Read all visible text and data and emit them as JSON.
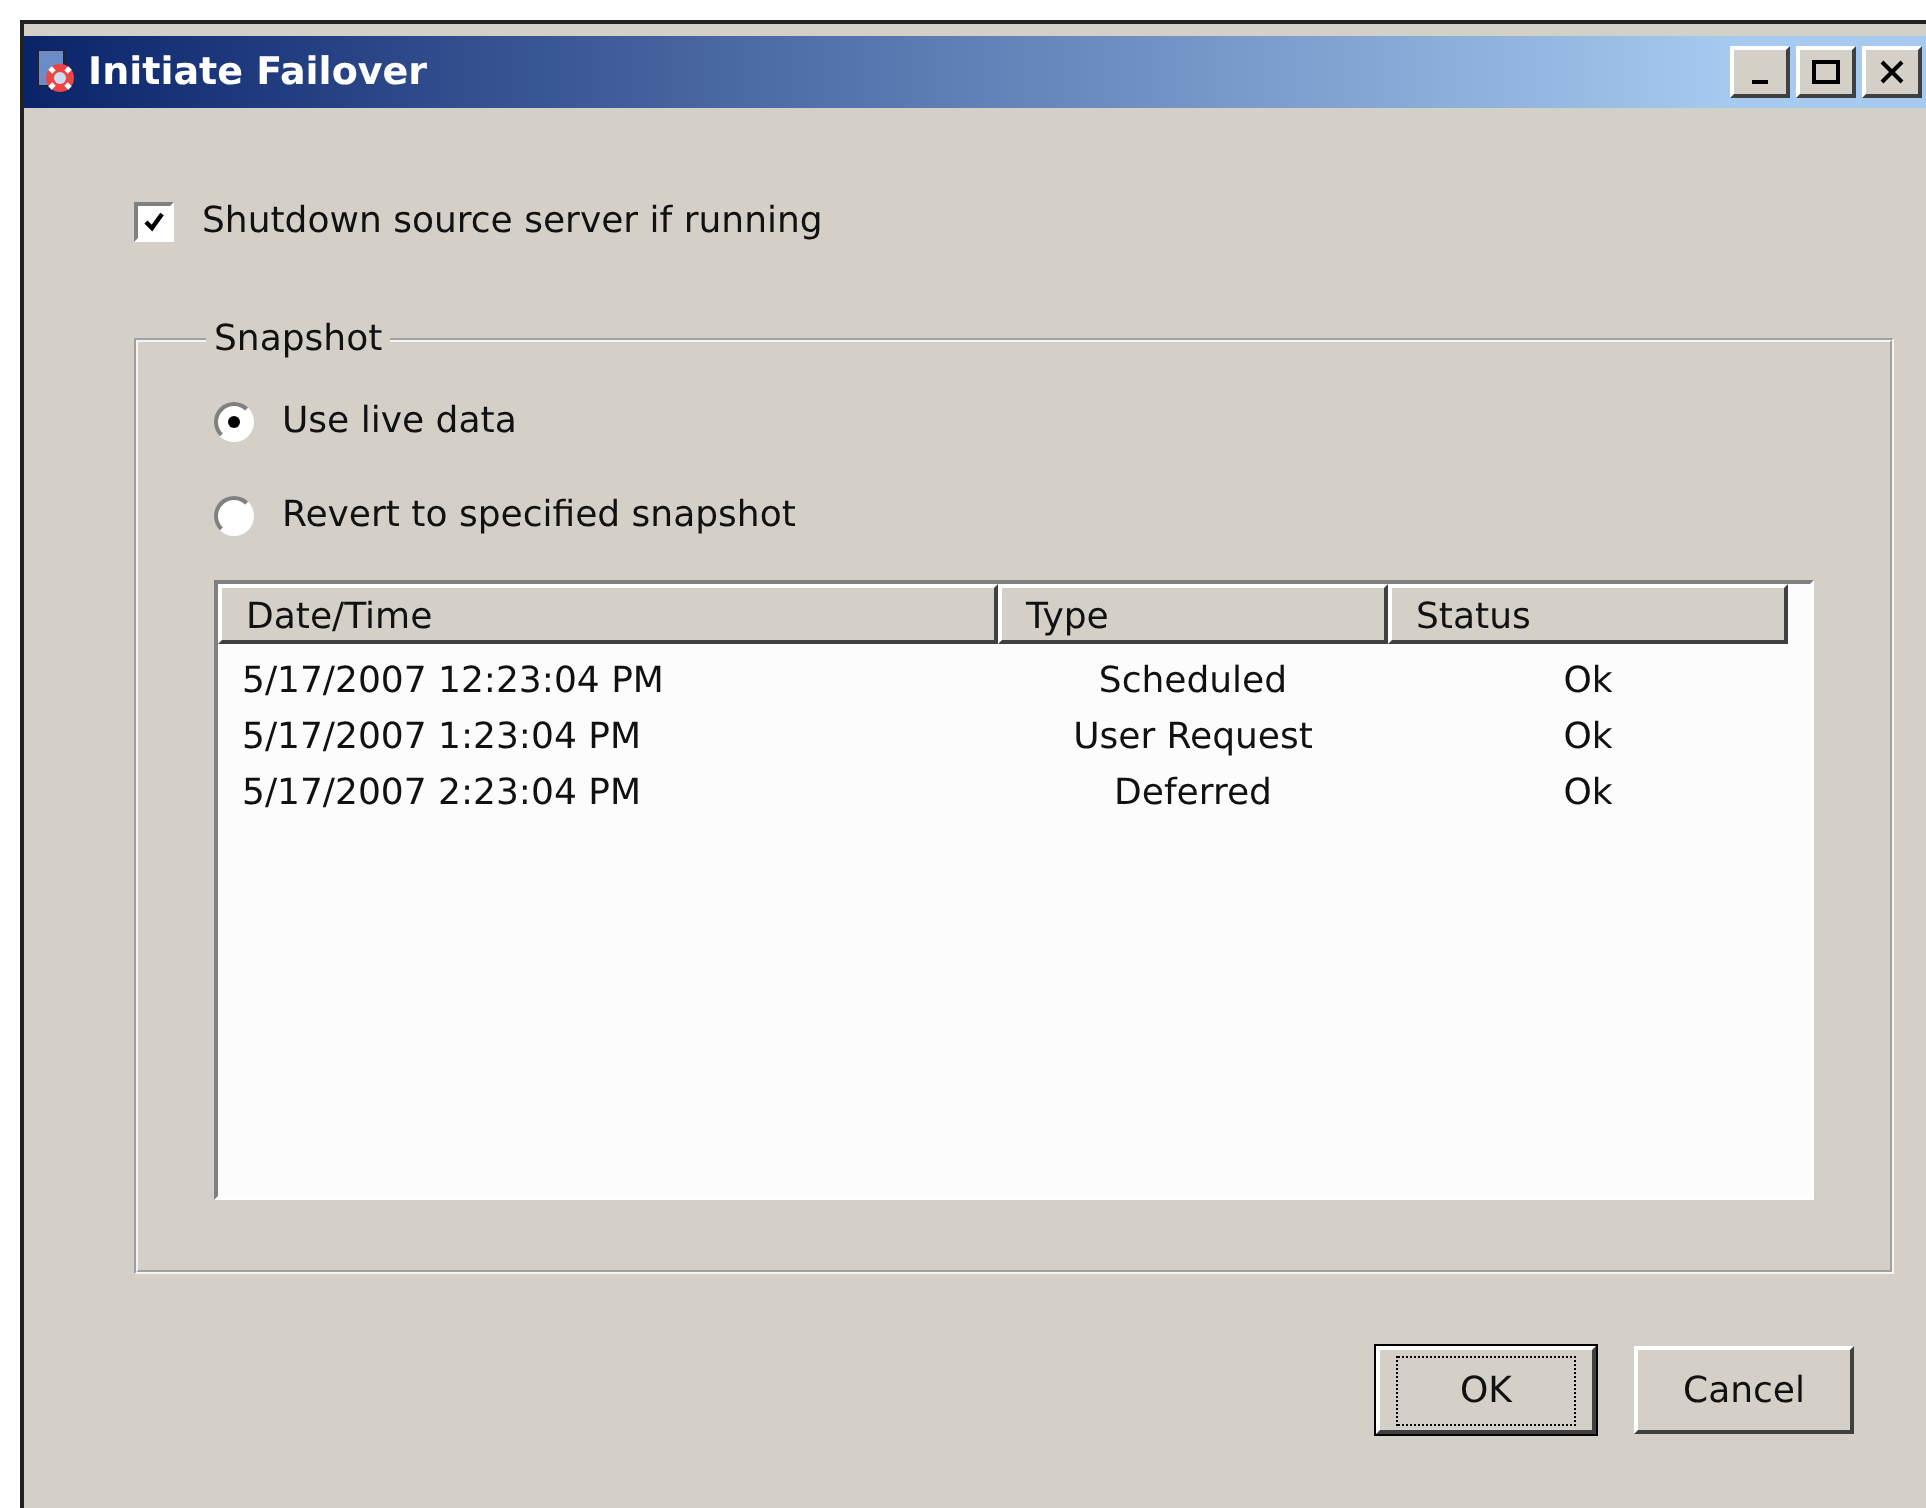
{
  "window": {
    "title": "Initiate Failover"
  },
  "shutdown_option": {
    "label": "Shutdown source server if running",
    "checked": true
  },
  "snapshot_group": {
    "label": "Snapshot",
    "options": [
      {
        "label": "Use live data",
        "selected": true
      },
      {
        "label": "Revert to specified snapshot",
        "selected": false
      }
    ],
    "table": {
      "columns": [
        "Date/Time",
        "Type",
        "Status"
      ],
      "rows": [
        [
          "5/17/2007 12:23:04 PM",
          "Scheduled",
          "Ok"
        ],
        [
          "5/17/2007 1:23:04 PM",
          "User Request",
          "Ok"
        ],
        [
          "5/17/2007 2:23:04 PM",
          "Deferred",
          "Ok"
        ]
      ]
    }
  },
  "buttons": [
    {
      "label": "OK",
      "default": true
    },
    {
      "label": "Cancel",
      "default": false
    }
  ]
}
